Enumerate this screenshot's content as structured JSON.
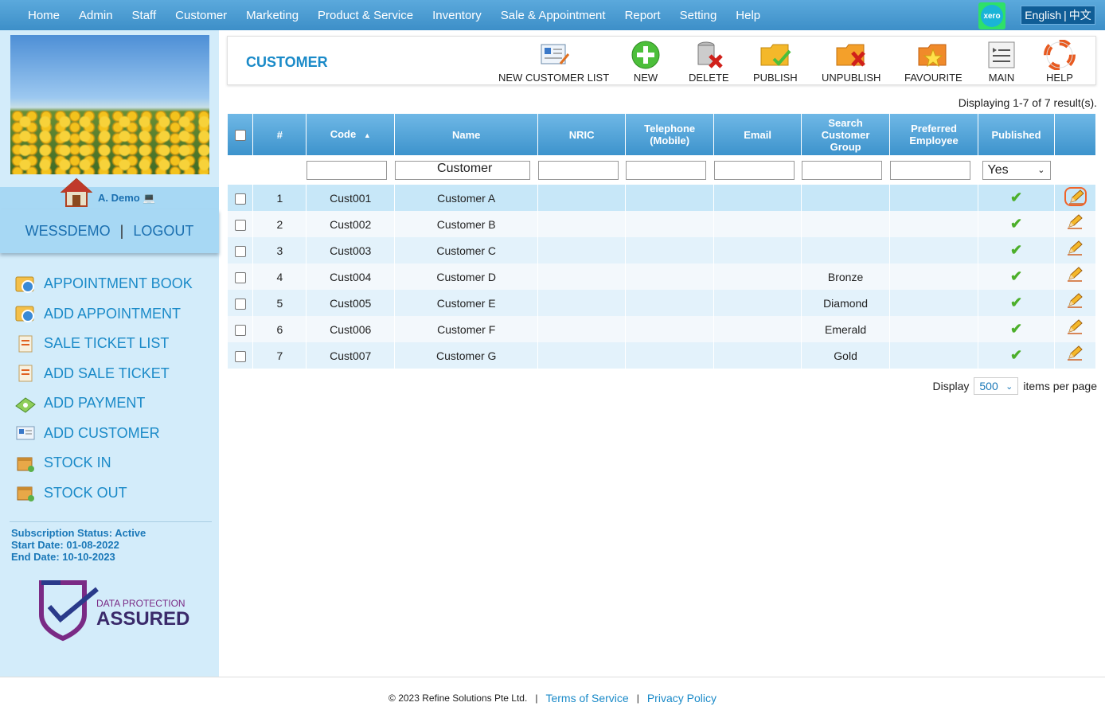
{
  "nav": {
    "items": [
      "Home",
      "Admin",
      "Staff",
      "Customer",
      "Marketing",
      "Product & Service",
      "Inventory",
      "Sale & Appointment",
      "Report",
      "Setting",
      "Help"
    ],
    "xero_label": "xero",
    "lang_en": "English",
    "lang_sep": "|",
    "lang_zh": "中文"
  },
  "sidebar": {
    "user_name": "A. Demo",
    "company": "WESSDEMO",
    "sep": "|",
    "logout": "LOGOUT",
    "menu": [
      {
        "label": "APPOINTMENT BOOK",
        "icon": "appointment-book-icon"
      },
      {
        "label": "ADD APPOINTMENT",
        "icon": "add-appointment-icon"
      },
      {
        "label": "SALE TICKET LIST",
        "icon": "sale-ticket-list-icon"
      },
      {
        "label": "ADD SALE TICKET",
        "icon": "add-sale-ticket-icon"
      },
      {
        "label": "ADD PAYMENT",
        "icon": "add-payment-icon"
      },
      {
        "label": "ADD CUSTOMER",
        "icon": "add-customer-icon"
      },
      {
        "label": "STOCK IN",
        "icon": "stock-in-icon"
      },
      {
        "label": "STOCK OUT",
        "icon": "stock-out-icon"
      }
    ],
    "subscription": {
      "status": "Subscription Status: Active",
      "start": "Start Date: 01-08-2022",
      "end": "End Date: 10-10-2023"
    },
    "badge": {
      "line1": "DATA PROTECTION",
      "line2": "ASSURED"
    }
  },
  "toolbar": {
    "title": "CUSTOMER",
    "new_customer_list": "NEW CUSTOMER LIST",
    "new": "NEW",
    "delete": "DELETE",
    "publish": "PUBLISH",
    "unpublish": "UNPUBLISH",
    "favourite": "FAVOURITE",
    "main": "MAIN",
    "help": "HELP"
  },
  "grid": {
    "result_info": "Displaying 1-7 of 7 result(s).",
    "headers": {
      "num": "#",
      "code": "Code",
      "name": "Name",
      "nric": "NRIC",
      "tel1": "Telephone",
      "tel2": "(Mobile)",
      "sg1": "Search",
      "sg2": "Customer",
      "sg3": "Group",
      "email": "Email",
      "pe1": "Preferred",
      "pe2": "Employee",
      "published": "Published"
    },
    "filters": {
      "name_value": "Customer",
      "published_value": "Yes"
    },
    "rows": [
      {
        "num": "1",
        "code": "Cust001",
        "name": "Customer A",
        "group": ""
      },
      {
        "num": "2",
        "code": "Cust002",
        "name": "Customer B",
        "group": ""
      },
      {
        "num": "3",
        "code": "Cust003",
        "name": "Customer C",
        "group": ""
      },
      {
        "num": "4",
        "code": "Cust004",
        "name": "Customer D",
        "group": "Bronze"
      },
      {
        "num": "5",
        "code": "Cust005",
        "name": "Customer E",
        "group": "Diamond"
      },
      {
        "num": "6",
        "code": "Cust006",
        "name": "Customer F",
        "group": "Emerald"
      },
      {
        "num": "7",
        "code": "Cust007",
        "name": "Customer G",
        "group": "Gold"
      }
    ],
    "paging": {
      "display": "Display",
      "per_page_value": "500",
      "items_per_page": "items per page"
    }
  },
  "footer": {
    "copyright": "© 2023 Refine Solutions Pte Ltd.",
    "sep": "|",
    "terms": "Terms of Service",
    "privacy": "Privacy Policy"
  }
}
